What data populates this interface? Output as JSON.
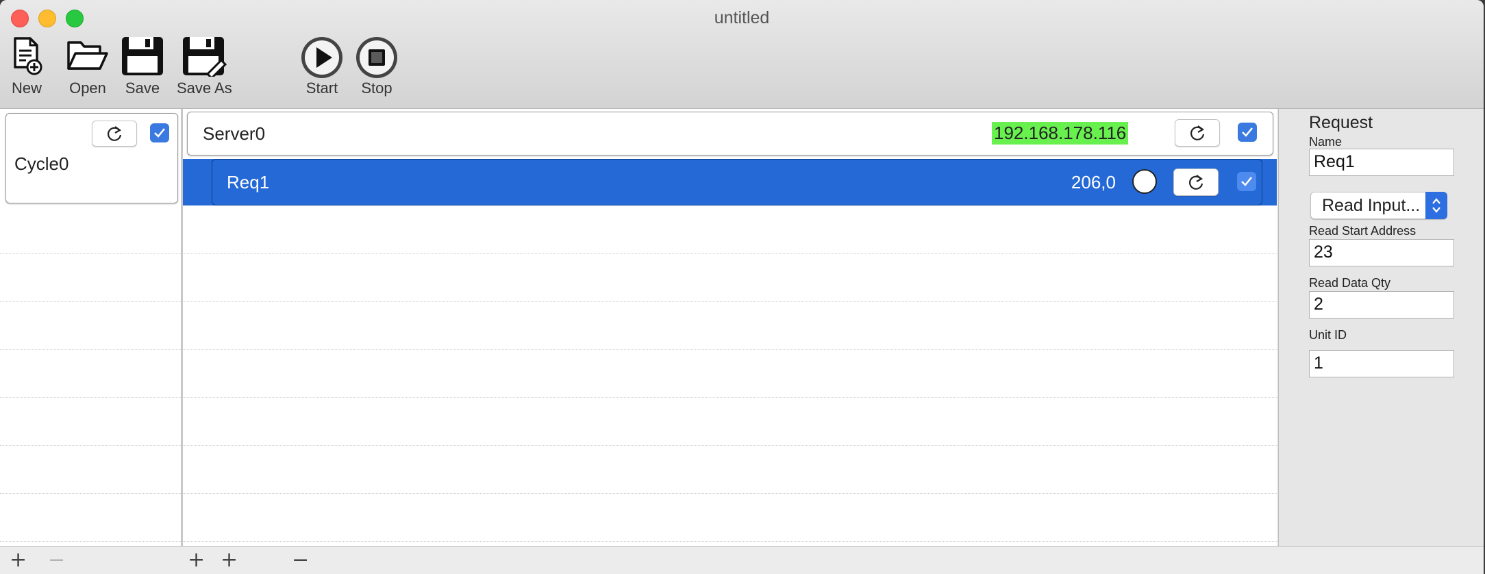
{
  "window": {
    "title": "untitled"
  },
  "toolbar": {
    "new_label": "New",
    "open_label": "Open",
    "save_label": "Save",
    "save_as_label": "Save As",
    "start_label": "Start",
    "stop_label": "Stop"
  },
  "cycles": [
    {
      "name": "Cycle0",
      "enabled": true
    }
  ],
  "servers": [
    {
      "name": "Server0",
      "ip": "192.168.178.116",
      "enabled": true
    }
  ],
  "requests": [
    {
      "name": "Req1",
      "value": "206,0",
      "enabled": true
    }
  ],
  "inspector": {
    "section_title": "Request",
    "name_label": "Name",
    "name_value": "Req1",
    "function_value": "Read Input...",
    "start_address_label": "Read Start Address",
    "start_address_value": "23",
    "data_qty_label": "Read Data Qty",
    "data_qty_value": "2",
    "unit_id_label": "Unit ID",
    "unit_id_value": "1"
  },
  "colors": {
    "selection": "#2469d6",
    "ip_highlight": "#67f04e",
    "checkbox": "#3a7ae0"
  },
  "icons": [
    "new-document-icon",
    "open-folder-icon",
    "save-icon",
    "save-as-icon",
    "start-icon",
    "stop-icon",
    "reload-icon",
    "checkmark-icon",
    "plus-icon",
    "minus-icon"
  ]
}
